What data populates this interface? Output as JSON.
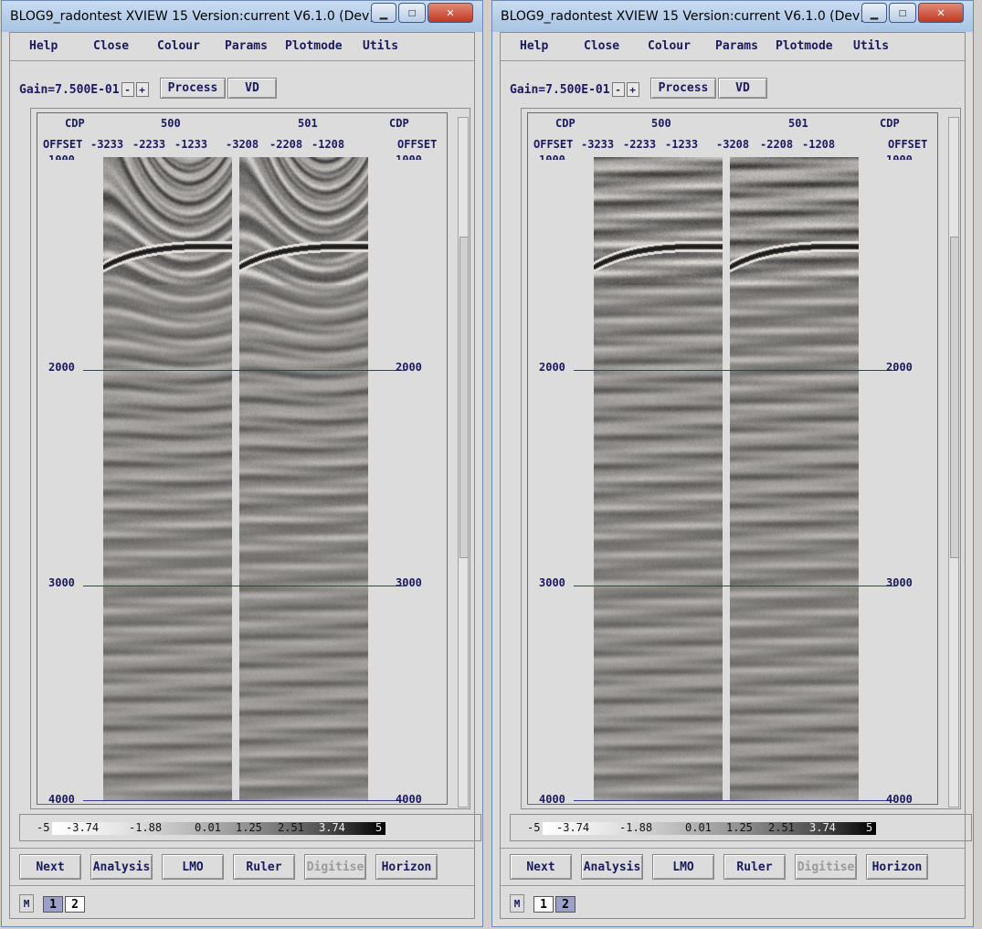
{
  "windows": [
    {
      "id": "left",
      "title": "BLOG9_radontest XVIEW 15   Version:current V6.1.0 (Dev)",
      "menu": [
        "Help",
        "Close",
        "Colour",
        "Params",
        "Plotmode",
        "Utils"
      ],
      "gain": "Gain=7.500E-01",
      "minus": "-",
      "plus": "+",
      "process": "Process",
      "vd": "VD",
      "cdp_label": "CDP",
      "offset_label": "OFFSET",
      "cdp1": "500",
      "cdp2": "501",
      "offsets1": [
        "-3233",
        "-2233",
        "-1233"
      ],
      "offsets2": [
        "-3208",
        "-2208",
        "-1208"
      ],
      "times": [
        "1000",
        "2000",
        "3000",
        "4000"
      ],
      "colorbar": [
        "-5",
        "-3.74",
        "-1.88",
        "0.01",
        "1.25",
        "2.51",
        "3.74",
        "5"
      ],
      "buttons": [
        "Next",
        "Analysis",
        "LMO",
        "Ruler",
        "Digitise",
        "Horizon"
      ],
      "m": "M",
      "pages": [
        "1",
        "2"
      ],
      "selected_page": 1
    },
    {
      "id": "right",
      "title": "BLOG9_radontest XVIEW 15   Version:current V6.1.0 (Dev)",
      "menu": [
        "Help",
        "Close",
        "Colour",
        "Params",
        "Plotmode",
        "Utils"
      ],
      "gain": "Gain=7.500E-01",
      "minus": "-",
      "plus": "+",
      "process": "Process",
      "vd": "VD",
      "cdp_label": "CDP",
      "offset_label": "OFFSET",
      "cdp1": "500",
      "cdp2": "501",
      "offsets1": [
        "-3233",
        "-2233",
        "-1233"
      ],
      "offsets2": [
        "-3208",
        "-2208",
        "-1208"
      ],
      "times": [
        "1000",
        "2000",
        "3000",
        "4000"
      ],
      "colorbar": [
        "-5",
        "-3.74",
        "-1.88",
        "0.01",
        "1.25",
        "2.51",
        "3.74",
        "5"
      ],
      "buttons": [
        "Next",
        "Analysis",
        "LMO",
        "Ruler",
        "Digitise",
        "Horizon"
      ],
      "m": "M",
      "pages": [
        "1",
        "2"
      ],
      "selected_page": 2
    }
  ],
  "colors": {
    "label": "#1a1a5e",
    "grid_line": "#2e3a8a",
    "selected_page": "#9aa0c9"
  },
  "icons": {
    "minimize": "minimize-icon",
    "maximize": "maximize-icon",
    "close": "close-icon"
  }
}
